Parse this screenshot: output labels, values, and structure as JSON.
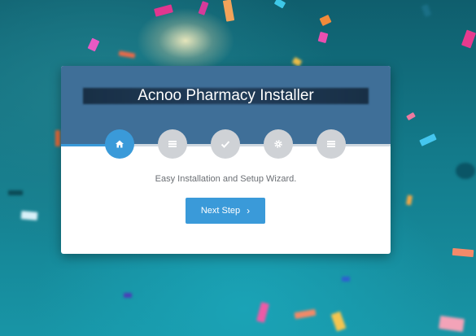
{
  "installer": {
    "title": "Acnoo Pharmacy Installer",
    "description": "Easy Installation and Setup Wizard.",
    "next_button_label": "Next Step",
    "next_button_icon": "chevron-right-icon",
    "accent_color": "#3a9ad9",
    "header_color": "#3f6f98",
    "steps": [
      {
        "icon": "home-icon",
        "active": true
      },
      {
        "icon": "list-icon",
        "active": false
      },
      {
        "icon": "check-icon",
        "active": false
      },
      {
        "icon": "gear-icon",
        "active": false
      },
      {
        "icon": "list-icon",
        "active": false
      }
    ]
  }
}
